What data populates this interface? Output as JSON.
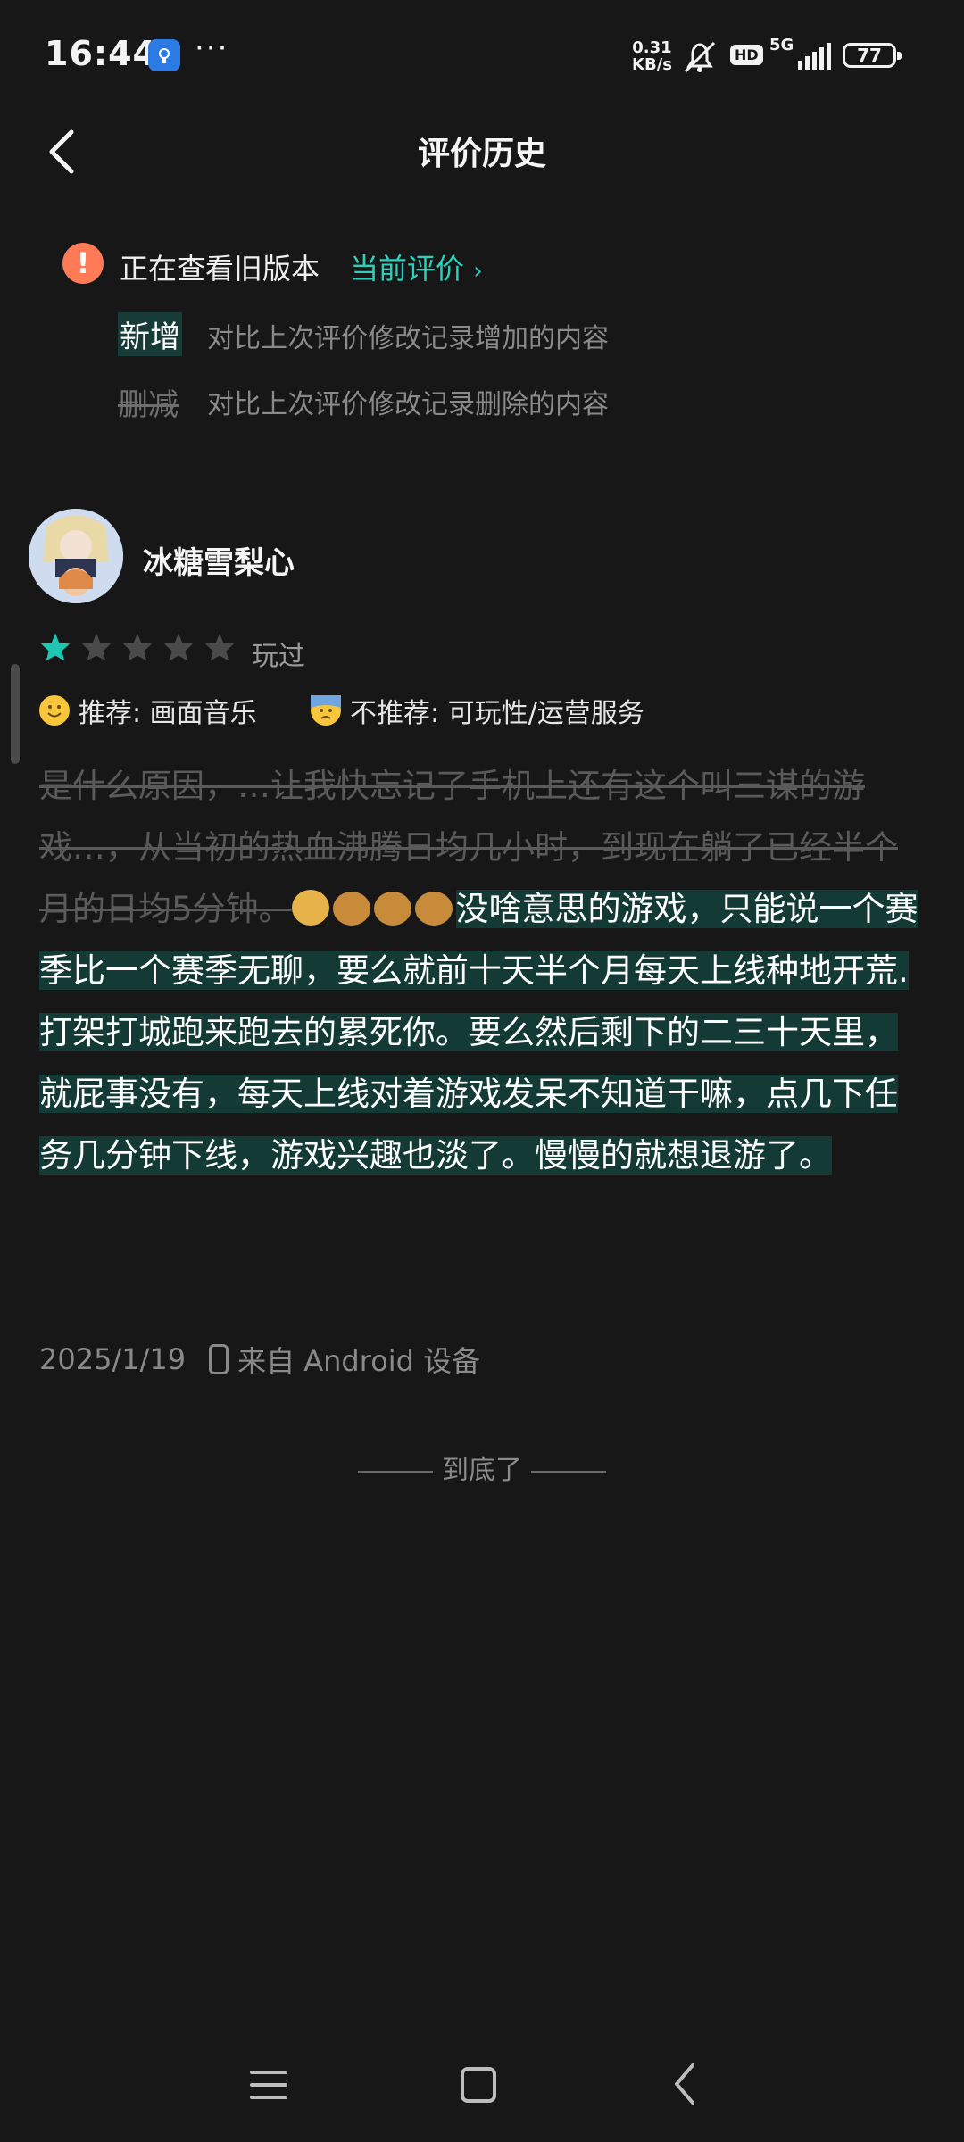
{
  "status_bar": {
    "time": "16:44",
    "more": "···",
    "net_speed_value": "0.31",
    "net_speed_unit": "KB/s",
    "hd": "HD",
    "network": "5G",
    "battery": "77"
  },
  "header": {
    "title": "评价历史"
  },
  "notice": {
    "text": "正在查看旧版本",
    "current_link": "当前评价",
    "added_label": "新增",
    "added_desc": "对比上次评价修改记录增加的内容",
    "deleted_label": "删减",
    "deleted_desc": "对比上次评价修改记录删除的内容"
  },
  "review": {
    "username": "冰糖雪梨心",
    "rating": 1,
    "rating_max": 5,
    "status": "玩过",
    "recommend": "推荐: 画面音乐",
    "not_recommend": "不推荐: 可玩性/运营服务",
    "deleted_text": "是什么原因，…让我快忘记了手机上还有这个叫三谋的游戏…，从当初的热血沸腾日均几小时，到现在躺了已经半个月的日均5分钟。",
    "added_text": "没啥意思的游戏，只能说一个赛季比一个赛季无聊，要么就前十天半个月每天上线种地开荒.打架打城跑来跑去的累死你。要么然后剩下的二三十天里，就屁事没有，每天上线对着游戏发呆不知道干嘛，点几下任务几分钟下线，游戏兴趣也淡了。慢慢的就想退游了。",
    "date": "2025/1/19",
    "device": "来自 Android 设备"
  },
  "footer": {
    "end_text": "到底了"
  },
  "colors": {
    "background": "#171717",
    "accent": "#2ad1bf",
    "added_bg": "#133a34",
    "warning": "#ff7a56"
  }
}
